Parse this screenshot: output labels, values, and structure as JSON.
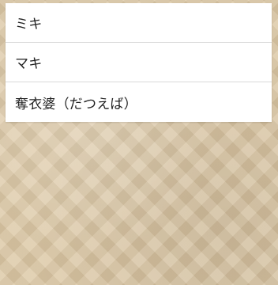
{
  "list": {
    "items": [
      {
        "label": "ミキ"
      },
      {
        "label": "マキ"
      },
      {
        "label": "奪衣婆（だつえば）"
      }
    ]
  }
}
